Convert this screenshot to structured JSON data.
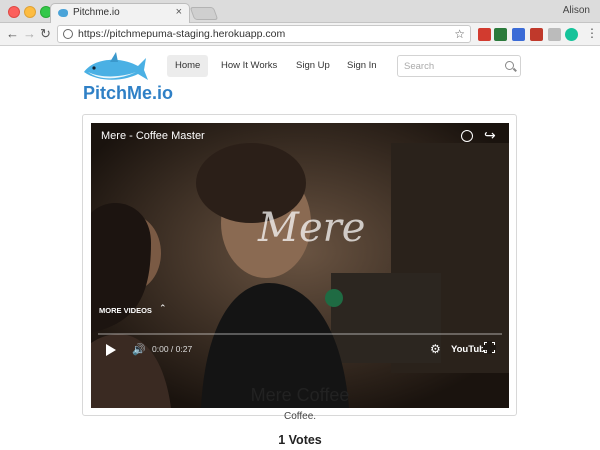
{
  "browser": {
    "tab_title": "Pitchme.io",
    "tab_close": "×",
    "user_name": "Alison",
    "url": "https://pitchmepuma-staging.herokuapp.com",
    "nav_back": "←",
    "nav_forward": "→",
    "nav_reload": "↻",
    "star": "☆",
    "menu": "⋮",
    "extensions": [
      {
        "icon": "onetab-icon",
        "color": "#d23b2f"
      },
      {
        "icon": "evernote-icon",
        "color": "#2b7a3b"
      },
      {
        "icon": "screencast-icon",
        "color": "#3b6bd6"
      },
      {
        "icon": "pdf-icon",
        "color": "#c0392b"
      },
      {
        "icon": "puzzle-icon",
        "color": "#bbbbbb"
      },
      {
        "icon": "grammarly-icon",
        "color": "#15c39a"
      }
    ]
  },
  "site": {
    "brand": "PitchMe.io",
    "nav": [
      {
        "label": "Home",
        "active": true
      },
      {
        "label": "How It Works",
        "active": false
      },
      {
        "label": "Sign Up",
        "active": false
      },
      {
        "label": "Sign In",
        "active": false
      }
    ],
    "search_placeholder": "Search",
    "accent": "#2f80c6"
  },
  "video": {
    "title": "Mere - Coffee Master",
    "watermark": "Mere",
    "more_videos": "MORE VIDEOS",
    "time": "0:00 / 0:27",
    "progress_percent": 0,
    "youtube_label": "YouTube",
    "share_icon": "↪",
    "volume_icon": "🔊",
    "gear_icon": "⚙",
    "chevron": "⌃"
  },
  "project": {
    "title": "Mere Coffee",
    "description": "Coffee.",
    "votes": "1 Votes"
  }
}
